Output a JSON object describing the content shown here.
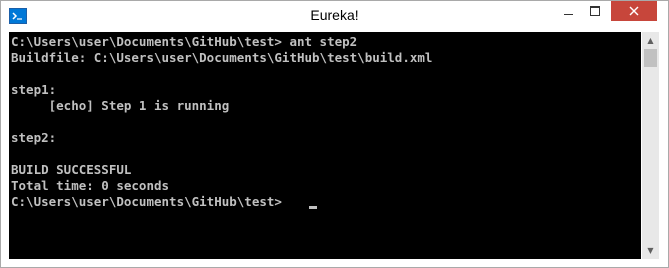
{
  "window": {
    "title": "Eureka!"
  },
  "icons": {
    "app": "terminal-icon",
    "minimize": "minimize-icon",
    "maximize": "maximize-icon",
    "close": "close-icon"
  },
  "console": {
    "lines": [
      "C:\\Users\\user\\Documents\\GitHub\\test> ant step2",
      "Buildfile: C:\\Users\\user\\Documents\\GitHub\\test\\build.xml",
      "",
      "step1:",
      "     [echo] Step 1 is running",
      "",
      "step2:",
      "",
      "BUILD SUCCESSFUL",
      "Total time: 0 seconds",
      "C:\\Users\\user\\Documents\\GitHub\\test> "
    ]
  },
  "colors": {
    "console_background": "#000000",
    "console_text": "#c0c0c0",
    "close_button": "#c7463b",
    "title_bar": "#ffffff"
  }
}
